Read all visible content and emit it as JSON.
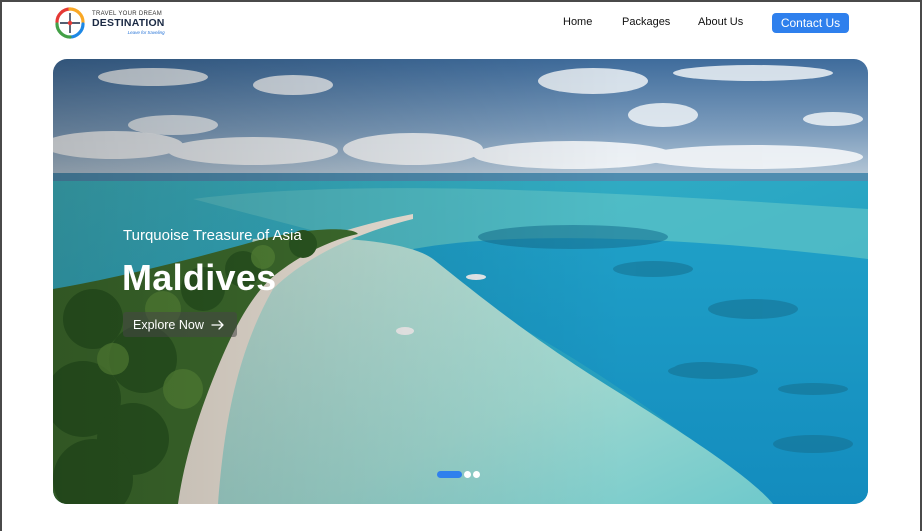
{
  "brand": {
    "top_line": "TRAVEL YOUR DREAM",
    "name": "DESTINATION",
    "tagline": "Leave for traveling"
  },
  "nav": {
    "items": [
      {
        "label": "Home"
      },
      {
        "label": "Packages"
      },
      {
        "label": "About Us"
      }
    ],
    "contact_label": "Contact Us"
  },
  "hero": {
    "subtitle": "Turquoise Treasure of Asia",
    "title": "Maldives",
    "cta_label": "Explore Now",
    "cta_icon": "arrow-right-icon",
    "slides_total": 3,
    "active_slide": 1
  },
  "colors": {
    "accent": "#2f80ed",
    "logo_red": "#e53935",
    "logo_green": "#43a047",
    "logo_yellow": "#f9a825",
    "logo_blue": "#1e88e5"
  }
}
